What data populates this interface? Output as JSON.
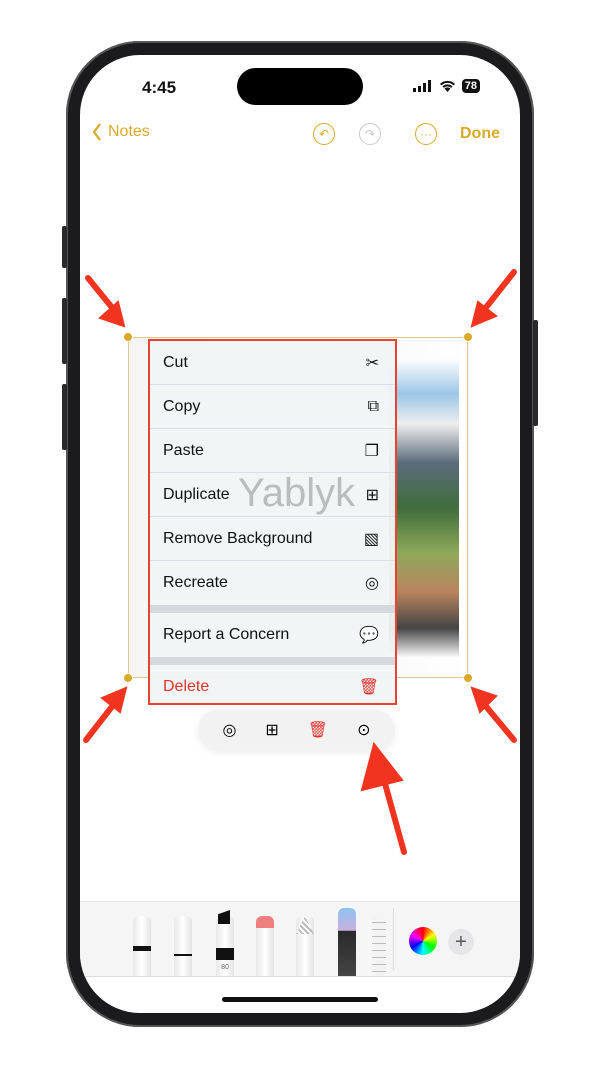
{
  "status_bar": {
    "time": "4:45",
    "battery": "78"
  },
  "nav": {
    "back_label": "Notes",
    "done_label": "Done"
  },
  "menu": {
    "items": [
      {
        "label": "Cut",
        "icon": "scissors-icon"
      },
      {
        "label": "Copy",
        "icon": "copy-icon"
      },
      {
        "label": "Paste",
        "icon": "paste-icon"
      },
      {
        "label": "Duplicate",
        "icon": "duplicate-icon"
      },
      {
        "label": "Remove Background",
        "icon": "image-icon"
      },
      {
        "label": "Recreate",
        "icon": "recreate-icon"
      },
      {
        "label": "Report a Concern",
        "icon": "report-icon"
      },
      {
        "label": "Delete",
        "icon": "trash-icon"
      }
    ]
  },
  "watermark": "Yablyk",
  "tools": {
    "marker_label": "80"
  },
  "colors": {
    "accent": "#d9a928",
    "highlight": "#e8432f",
    "delete": "#e0322b"
  }
}
